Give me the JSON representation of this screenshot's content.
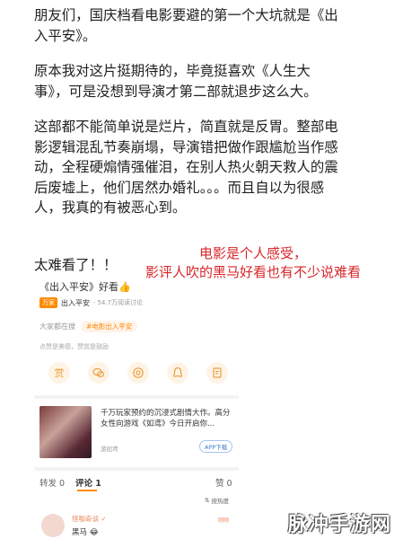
{
  "article": {
    "p1": "朋友们，国庆档看电影要避的第一个大坑就是《出入平安》。",
    "p2": "原本我对这片挺期待的，毕竟挺喜欢《人生大事》，可是没想到导演才第二部就退步这么大。",
    "p3": "这部都不能简单说是烂片，简直就是反胃。整部电影逻辑混乱节奏崩塌，导演错把做作跟尴尬当作感动，全程硬煽情强催泪，在别人热火朝天救人的震后废墟上，他们居然办婚礼。。。而且自以为很感人，我真的有被恶心到。",
    "p4": "太难看了！！"
  },
  "annotation": {
    "line1": "电影是个人感受，",
    "line2": "影评人吹的黑马好看也有不少说难看"
  },
  "post": {
    "title": "《出入平安》好看👍",
    "tag_badge": "万家",
    "tag_text": "出入平安",
    "tag_count": "· 54.7万阅读讨论",
    "hot_label": "大家都在搜",
    "hot_tag": "#电影出入平安",
    "hint": "点赞是美德，赞赏是鼓励"
  },
  "share_icons": [
    "money-icon",
    "wechat-icon",
    "moments-icon",
    "qq-icon",
    "edit-icon"
  ],
  "ad": {
    "title": "千万玩家预约的沉浸式剧情大作。高分女性向游戏《如鸢》今日开启你...",
    "source": "游如鸢",
    "button": "APP下载"
  },
  "tabs": {
    "repost": "转发 0",
    "comments": "评论 1",
    "likes": "赞 0"
  },
  "sort": "按热度",
  "comment": {
    "user": "怪咖奇谈 ✓ ",
    "text": "黑马 😂",
    "time": "刚刚"
  },
  "watermark": "脉冲手游网",
  "colors": {
    "accent": "#ff8a00",
    "annotation": "#d8262a"
  }
}
